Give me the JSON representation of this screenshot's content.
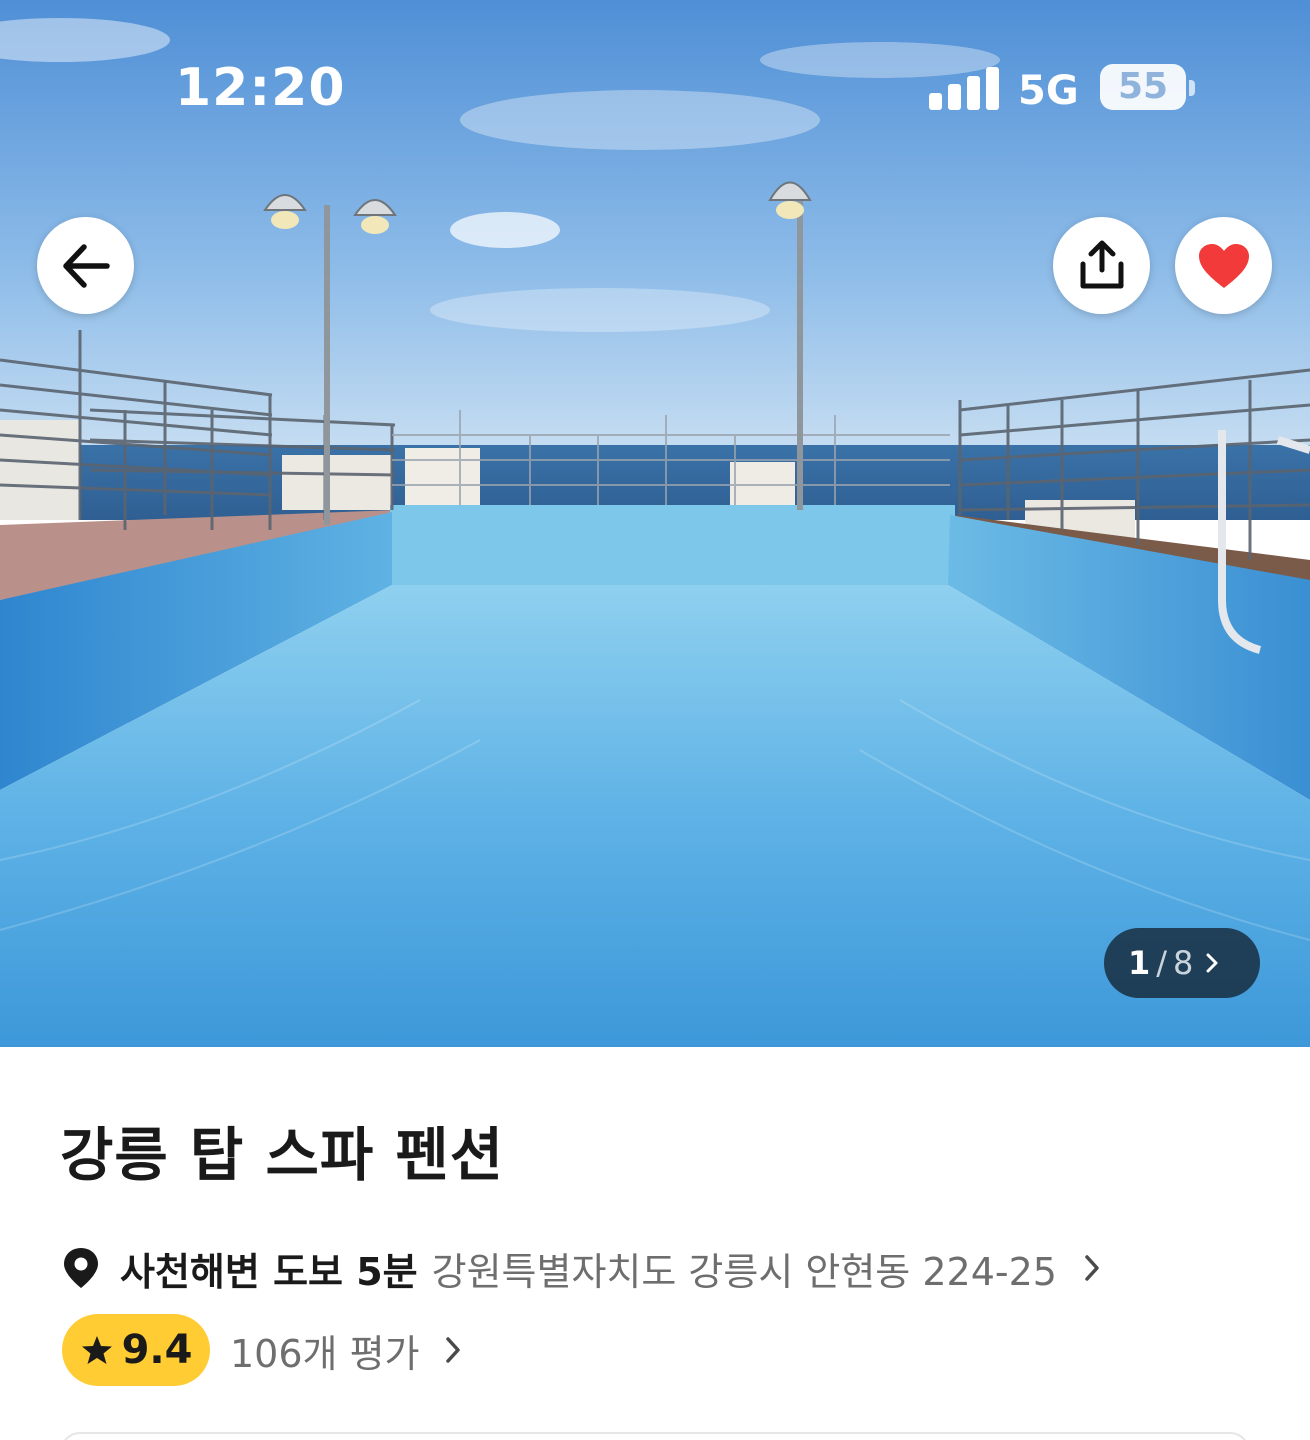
{
  "status_bar": {
    "time": "12:20",
    "network": "5G",
    "battery": "55"
  },
  "hero": {
    "photo_current": "1",
    "photo_total": "8"
  },
  "property": {
    "name": "강릉 탑 스파 펜션",
    "location_highlight": "사천해변 도보 5분",
    "address": "강원특별자치도 강릉시 안현동 224-25",
    "rating": "9.4",
    "reviews": "106개 평가"
  },
  "colors": {
    "rating_badge": "#ffcc33",
    "favorite_heart": "#f23a3a"
  },
  "icons": {
    "back": "arrow-left-icon",
    "share": "share-icon",
    "favorite": "heart-icon",
    "location": "location-pin-icon",
    "rating": "star-icon",
    "chevron": "chevron-right-icon"
  }
}
